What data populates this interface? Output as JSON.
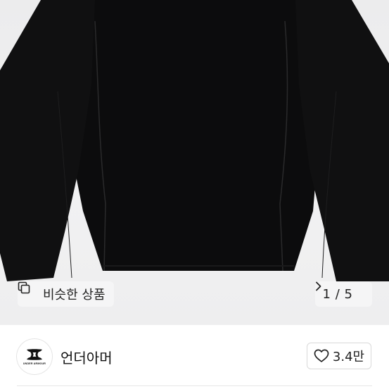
{
  "gallery": {
    "similar_label": "비슷한 상품",
    "counter": "1 / 5",
    "similar_icon": "copy-icon",
    "next_icon": "chevron-right-icon"
  },
  "seller": {
    "name": "언더아머",
    "avatar_text": "UNDER ARMOUR",
    "like_count": "3.4만",
    "like_icon": "heart-outline-icon"
  }
}
